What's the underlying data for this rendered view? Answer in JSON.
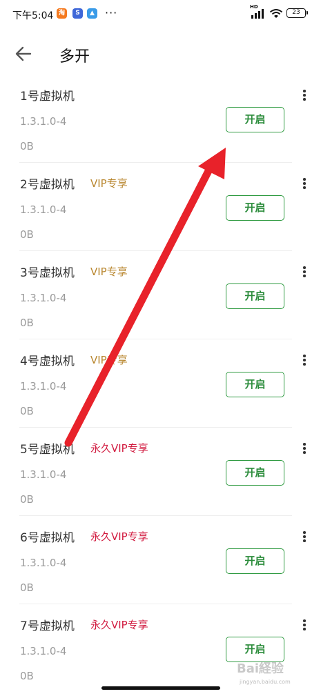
{
  "status_bar": {
    "time": "下午5:04",
    "dots": "···",
    "network": "HD",
    "battery": "23"
  },
  "header": {
    "title": "多开"
  },
  "vm_list": [
    {
      "name": "1号虚拟机",
      "badge": "",
      "badge_type": "",
      "version": "1.3.1.0-4",
      "size": "0B",
      "button": "开启"
    },
    {
      "name": "2号虚拟机",
      "badge": "VIP专享",
      "badge_type": "vip",
      "version": "1.3.1.0-4",
      "size": "0B",
      "button": "开启"
    },
    {
      "name": "3号虚拟机",
      "badge": "VIP专享",
      "badge_type": "vip",
      "version": "1.3.1.0-4",
      "size": "0B",
      "button": "开启"
    },
    {
      "name": "4号虚拟机",
      "badge": "VIP专享",
      "badge_type": "vip",
      "version": "1.3.1.0-4",
      "size": "0B",
      "button": "开启"
    },
    {
      "name": "5号虚拟机",
      "badge": "永久VIP专享",
      "badge_type": "perm",
      "version": "1.3.1.0-4",
      "size": "0B",
      "button": "开启"
    },
    {
      "name": "6号虚拟机",
      "badge": "永久VIP专享",
      "badge_type": "perm",
      "version": "1.3.1.0-4",
      "size": "0B",
      "button": "开启"
    },
    {
      "name": "7号虚拟机",
      "badge": "永久VIP专享",
      "badge_type": "perm",
      "version": "1.3.1.0-4",
      "size": "0B",
      "button": "开启"
    }
  ],
  "watermark": {
    "text": "Bai経验",
    "url": "jingyan.baidu.com"
  },
  "colors": {
    "accent_green": "#2e9a40",
    "vip_gold": "#b8862e",
    "perm_vip_red": "#d11a3f",
    "arrow_red": "#e8222a"
  }
}
